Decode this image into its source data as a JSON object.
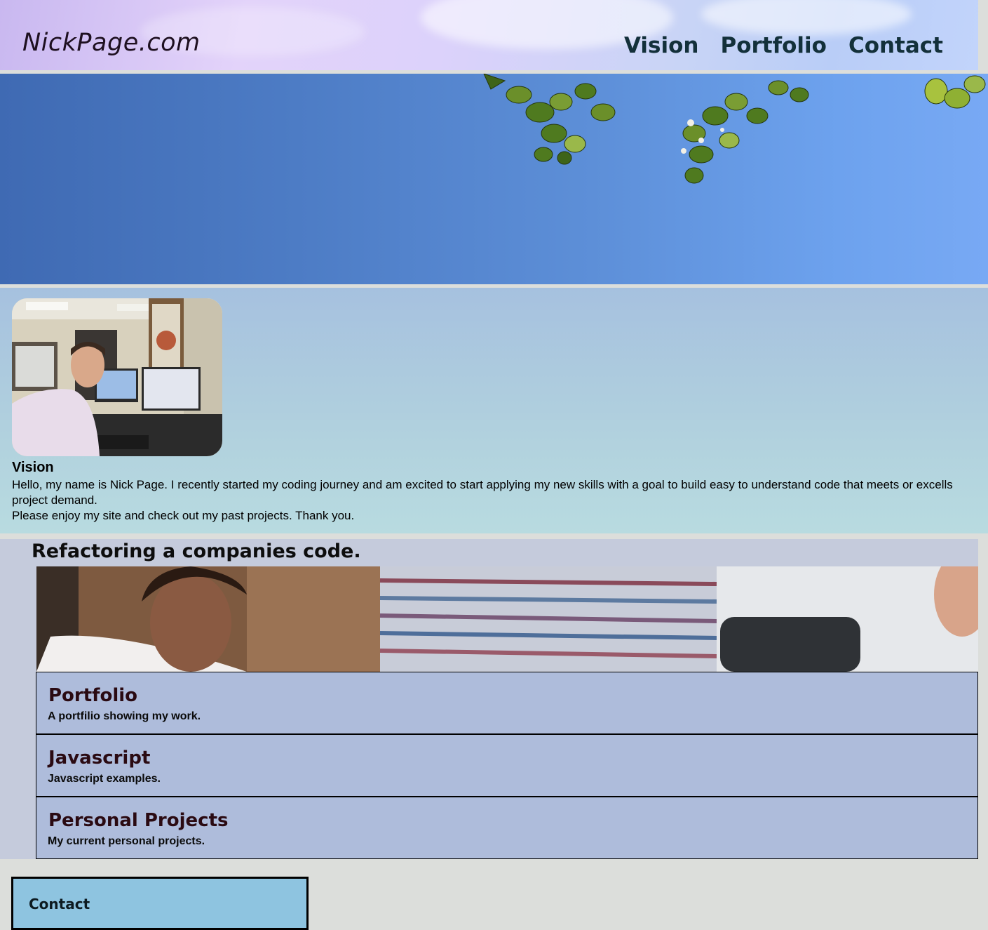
{
  "header": {
    "brand": "NickPage.com",
    "nav": [
      "Vision",
      "Portfolio",
      "Contact"
    ]
  },
  "vision": {
    "heading": "Vision",
    "paragraphs": [
      "Hello, my name is Nick Page. I recently started my coding journey and am excited to start applying my new skills with a goal to build easy to understand code that meets or excells project demand.",
      "Please enjoy my site and check out my past projects. Thank you."
    ]
  },
  "works": {
    "heading": "Refactoring a companies code.",
    "cards": [
      {
        "title": "Portfolio",
        "desc": "A portfilio showing my work."
      },
      {
        "title": "Javascript",
        "desc": "Javascript examples."
      },
      {
        "title": "Personal Projects",
        "desc": "My current personal projects."
      }
    ]
  },
  "contact": {
    "label": "Contact"
  },
  "colors": {
    "page_bg": "#dcdedb",
    "card_bg": "#aebcdb",
    "contact_bg": "#8ec4e0"
  }
}
